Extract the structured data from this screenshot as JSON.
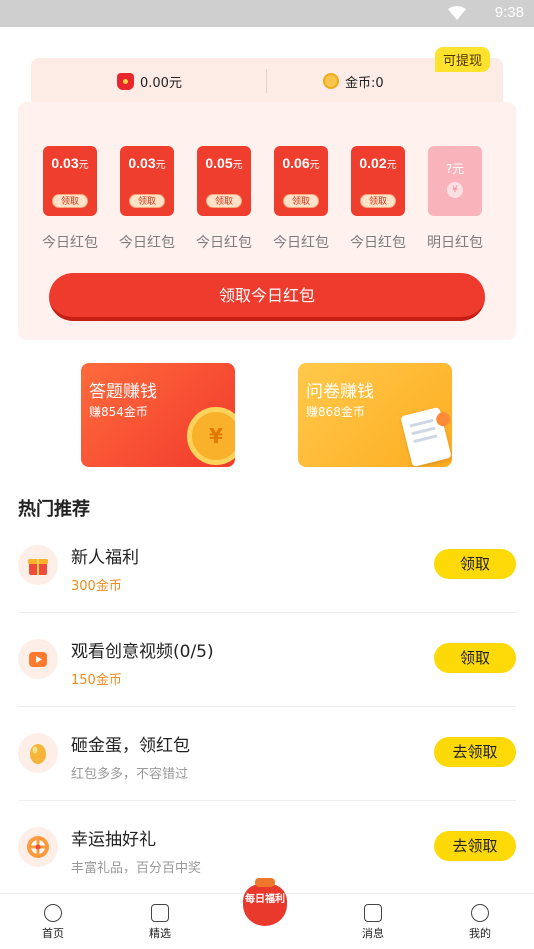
{
  "status_bar": {
    "time": "9:38"
  },
  "balance": {
    "cash": "0.00元",
    "coins": "金币:0",
    "withdraw_tag": "可提现"
  },
  "envelopes": [
    {
      "amount": "0.03",
      "unit": "元",
      "button": "领取",
      "caption": "今日红包"
    },
    {
      "amount": "0.03",
      "unit": "元",
      "button": "领取",
      "caption": "今日红包"
    },
    {
      "amount": "0.05",
      "unit": "元",
      "button": "领取",
      "caption": "今日红包"
    },
    {
      "amount": "0.06",
      "unit": "元",
      "button": "领取",
      "caption": "今日红包"
    },
    {
      "amount": "0.02",
      "unit": "元",
      "button": "领取",
      "caption": "今日红包"
    }
  ],
  "future_envelope": {
    "label": "?元",
    "coin": "¥",
    "caption": "明日红包"
  },
  "claim_button": "领取今日红包",
  "tasks": [
    {
      "title": "答题赚钱",
      "subtitle": "赚854金币",
      "coin_symbol": "¥"
    },
    {
      "title": "问卷赚钱",
      "subtitle": "赚868金币"
    }
  ],
  "section_title": "热门推荐",
  "recommendations": [
    {
      "name": "新人福利",
      "desc": "300金币",
      "button": "领取",
      "icon": "gift-icon"
    },
    {
      "name": "观看创意视频(0/5)",
      "desc": "150金币",
      "button": "领取",
      "icon": "video-icon"
    },
    {
      "name": "砸金蛋，领红包",
      "desc": "红包多多，不容错过",
      "button": "去领取",
      "icon": "golden-egg-icon"
    },
    {
      "name": "幸运抽好礼",
      "desc": "丰富礼品，百分百中奖",
      "button": "去领取",
      "icon": "lucky-wheel-icon"
    }
  ],
  "nav": {
    "home": "首页",
    "featured": "精选",
    "daily": "每日福利",
    "messages": "消息",
    "profile": "我的"
  },
  "colors": {
    "accent_red": "#ee3b2e",
    "accent_yellow": "#fdd908",
    "coin_orange": "#f18c1c"
  }
}
